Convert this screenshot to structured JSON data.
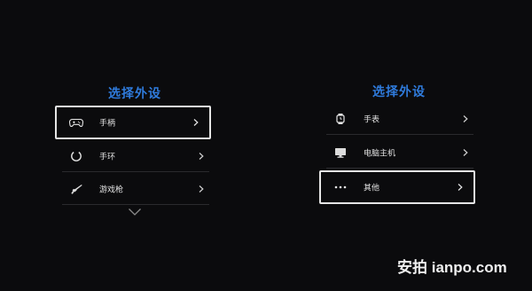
{
  "left_panel": {
    "title": "选择外设",
    "items": [
      {
        "label": "手柄",
        "icon": "gamepad-icon",
        "selected": true
      },
      {
        "label": "手环",
        "icon": "ring-band-icon",
        "selected": false
      },
      {
        "label": "游戏枪",
        "icon": "gun-icon",
        "selected": false
      }
    ],
    "more_indicator": "chevron-down-icon"
  },
  "right_panel": {
    "title": "选择外设",
    "items": [
      {
        "label": "手表",
        "icon": "watch-icon",
        "selected": false
      },
      {
        "label": "电脑主机",
        "icon": "monitor-icon",
        "selected": false
      },
      {
        "label": "其他",
        "icon": "more-dots-icon",
        "selected": true
      }
    ]
  },
  "watermark": {
    "text": "安拍 ianpo.com"
  },
  "colors": {
    "background": "#0b0b0d",
    "title": "#2f7bdc",
    "selection_border": "#e6e6e6",
    "divider": "#2a2a2d"
  }
}
